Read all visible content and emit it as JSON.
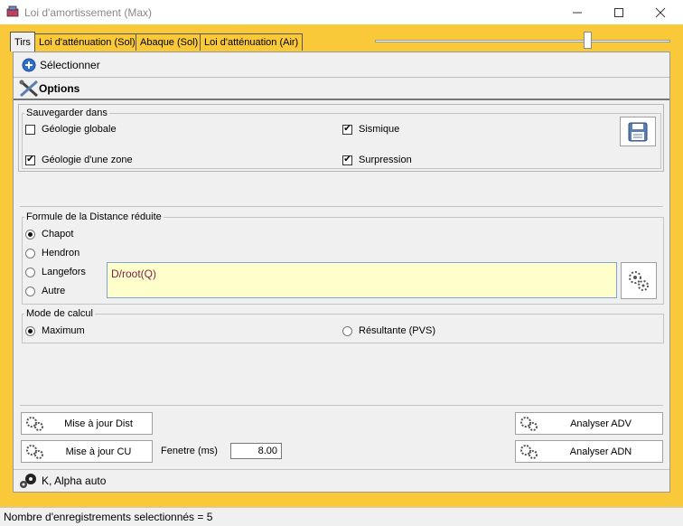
{
  "window": {
    "title": "Loi d'amortissement (Max)"
  },
  "tabs": [
    {
      "label": "Tirs",
      "active": true
    },
    {
      "label": "Loi d'atténuation (Sol)",
      "active": false
    },
    {
      "label": "Abaque (Sol)",
      "active": false
    },
    {
      "label": "Loi d'atténuation (Air)",
      "active": false
    }
  ],
  "strips": {
    "select_label": "Sélectionner",
    "options_label": "Options"
  },
  "save_group": {
    "legend": "Sauvegarder dans",
    "items": [
      {
        "label": "Géologie globale",
        "checked": false
      },
      {
        "label": "Sismique",
        "checked": true
      },
      {
        "label": "Géologie d'une zone",
        "checked": true
      },
      {
        "label": "Surpression",
        "checked": true
      }
    ]
  },
  "formula_group": {
    "legend": "Formule de la Distance réduite",
    "options": [
      {
        "label": "Chapot",
        "selected": true
      },
      {
        "label": "Hendron",
        "selected": false
      },
      {
        "label": "Langefors",
        "selected": false
      },
      {
        "label": "Autre",
        "selected": false
      }
    ],
    "formula_value": "D/root(Q)"
  },
  "calc_group": {
    "legend": "Mode de calcul",
    "options": [
      {
        "label": "Maximum",
        "selected": true
      },
      {
        "label": "Résultante (PVS)",
        "selected": false
      }
    ]
  },
  "actions": {
    "update_dist": "Mise à jour Dist",
    "update_cu": "Mise à jour CU",
    "fenetre_label": "Fenetre (ms)",
    "fenetre_value": "8.00",
    "analyse_adv": "Analyser ADV",
    "analyse_adn": "Analyser ADN",
    "alpha_auto": "K, Alpha auto"
  },
  "status": {
    "text": "Nombre d'enregistrements selectionnés = 5"
  },
  "colors": {
    "accent": "#f9c93a",
    "panel": "#f0f0f0",
    "formula_bg": "#ffffcc",
    "formula_text": "#7a1f4a"
  },
  "slider": {
    "level": 0.72
  }
}
